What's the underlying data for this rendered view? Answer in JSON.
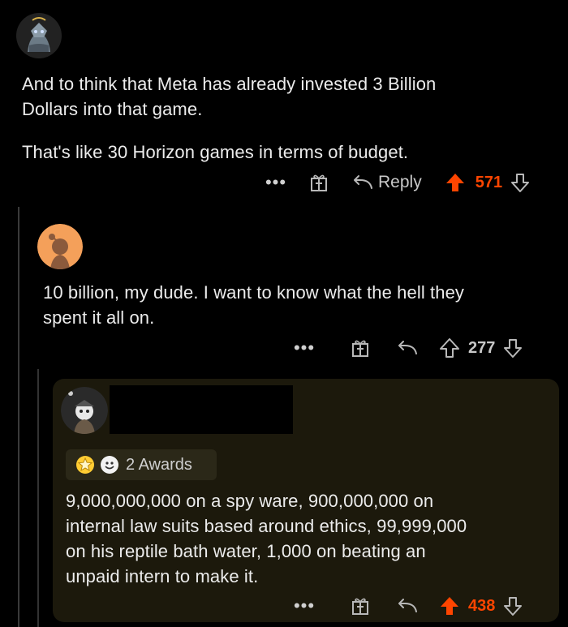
{
  "comments": [
    {
      "text_line1": "And to think that Meta has already invested 3 Billion",
      "text_line2": "Dollars into that game.",
      "text_line3": "That's like 30 Horizon games in terms of budget.",
      "actions": {
        "more": "•••",
        "reply": "Reply",
        "score": "571"
      },
      "vote_state": "upvoted"
    },
    {
      "text_line1": "10 billion, my dude. I want to know what the hell they",
      "text_line2": "spent it all on.",
      "actions": {
        "more": "•••",
        "score": "277"
      },
      "vote_state": "none"
    },
    {
      "awards": "2 Awards",
      "text_line1": "9,000,000,000 on a spy ware, 900,000,000 on",
      "text_line2": "internal law suits based around ethics, 99,999,000",
      "text_line3": "on his reptile bath water, 1,000 on beating an",
      "text_line4": "unpaid intern to make it.",
      "actions": {
        "more": "•••",
        "score": "438"
      },
      "vote_state": "upvoted"
    }
  ],
  "colors": {
    "upvote": "#ff4500",
    "highlight_bg": "#1e1a0b",
    "text": "#ececec"
  }
}
